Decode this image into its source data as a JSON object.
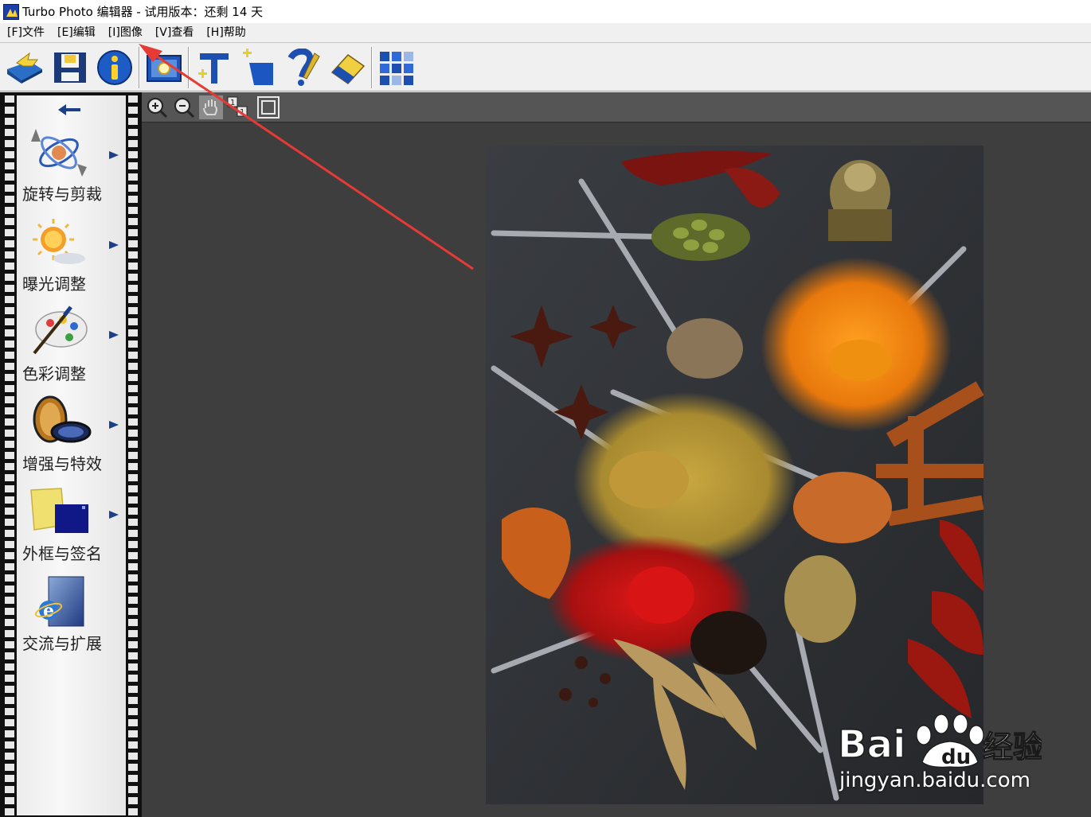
{
  "window": {
    "title": "Turbo Photo 编辑器  - 试用版本：还剩 14 天"
  },
  "menu": {
    "items": [
      {
        "label": "[F]文件",
        "name": "menu-file"
      },
      {
        "label": "[E]编辑",
        "name": "menu-edit"
      },
      {
        "label": "[I]图像",
        "name": "menu-image"
      },
      {
        "label": "[V]查看",
        "name": "menu-view"
      },
      {
        "label": "[H]帮助",
        "name": "menu-help"
      }
    ]
  },
  "toolbar": {
    "buttons": [
      {
        "name": "open-icon"
      },
      {
        "name": "save-icon"
      },
      {
        "name": "info-icon"
      },
      {
        "name": "capture-icon"
      },
      {
        "name": "text-icon"
      },
      {
        "name": "add-layer-icon"
      },
      {
        "name": "help-icon"
      },
      {
        "name": "eraser-icon"
      },
      {
        "name": "thumbnails-icon"
      }
    ]
  },
  "sidebar": {
    "back_icon": "back-arrow-icon",
    "items": [
      {
        "label": "旋转与剪裁",
        "icon": "rotate-crop-icon",
        "has_submenu": true
      },
      {
        "label": "曝光调整",
        "icon": "exposure-icon",
        "has_submenu": true
      },
      {
        "label": "色彩调整",
        "icon": "color-palette-icon",
        "has_submenu": true
      },
      {
        "label": "增强与特效",
        "icon": "lens-effects-icon",
        "has_submenu": true
      },
      {
        "label": "外框与签名",
        "icon": "frame-signature-icon",
        "has_submenu": true
      },
      {
        "label": "交流与扩展",
        "icon": "share-extend-icon",
        "has_submenu": false
      }
    ]
  },
  "viewer_toolbar": {
    "buttons": [
      {
        "name": "zoom-in-icon"
      },
      {
        "name": "zoom-out-icon"
      },
      {
        "name": "pan-hand-icon"
      },
      {
        "name": "actual-size-icon"
      },
      {
        "name": "fit-window-icon"
      }
    ]
  },
  "watermark": {
    "brand": "Bai 经验",
    "url": "jingyan.baidu.com"
  },
  "colors": {
    "workspace": "#3d3d3d",
    "annotation_arrow": "#e83a34"
  }
}
